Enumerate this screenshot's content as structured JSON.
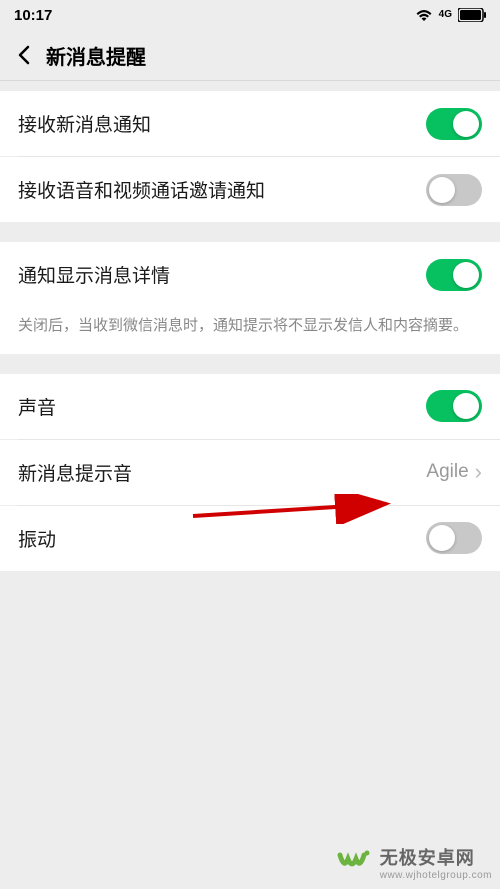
{
  "status": {
    "time": "10:17",
    "network": "4G"
  },
  "nav": {
    "title": "新消息提醒"
  },
  "settings": {
    "receive_new": {
      "label": "接收新消息通知",
      "on": true
    },
    "receive_call": {
      "label": "接收语音和视频通话邀请通知",
      "on": false
    },
    "show_detail": {
      "label": "通知显示消息详情",
      "on": true,
      "desc": "关闭后，当收到微信消息时，通知提示将不显示发信人和内容摘要。"
    },
    "sound": {
      "label": "声音",
      "on": true
    },
    "sound_tone": {
      "label": "新消息提示音",
      "value": "Agile"
    },
    "vibrate": {
      "label": "振动",
      "on": false
    }
  },
  "watermark": {
    "brand": "无极安卓网",
    "url": "www.wjhotelgroup.com"
  }
}
